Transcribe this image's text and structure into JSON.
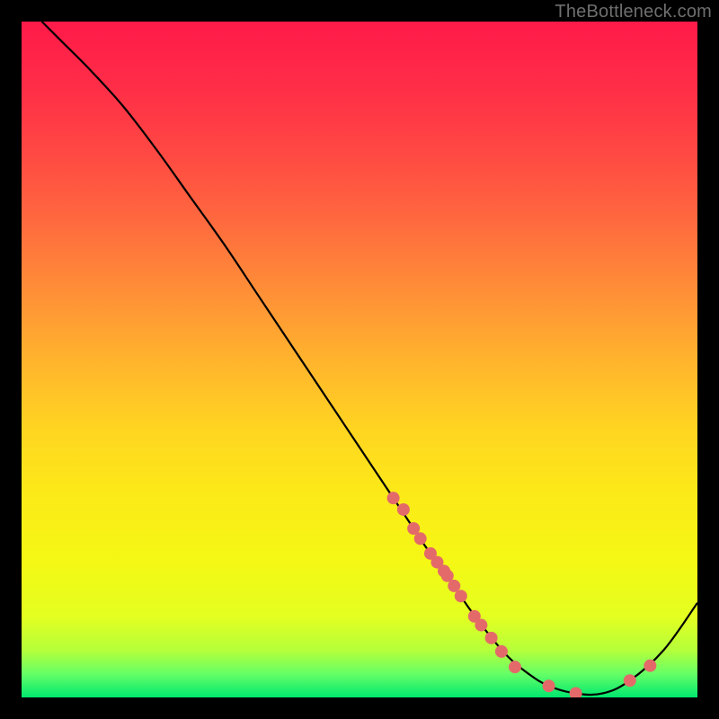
{
  "watermark": "TheBottleneck.com",
  "gradient": {
    "stops": [
      {
        "offset": 0.0,
        "color": "#ff1a49"
      },
      {
        "offset": 0.1,
        "color": "#ff2e47"
      },
      {
        "offset": 0.2,
        "color": "#ff4a43"
      },
      {
        "offset": 0.3,
        "color": "#ff6b3e"
      },
      {
        "offset": 0.4,
        "color": "#ff8f37"
      },
      {
        "offset": 0.5,
        "color": "#ffb32d"
      },
      {
        "offset": 0.6,
        "color": "#ffd421"
      },
      {
        "offset": 0.7,
        "color": "#fcea18"
      },
      {
        "offset": 0.8,
        "color": "#f4f814"
      },
      {
        "offset": 0.88,
        "color": "#e4ff20"
      },
      {
        "offset": 0.93,
        "color": "#b5ff3a"
      },
      {
        "offset": 0.965,
        "color": "#66ff66"
      },
      {
        "offset": 1.0,
        "color": "#00e76f"
      }
    ]
  },
  "chart_data": {
    "type": "line",
    "title": "",
    "xlabel": "",
    "ylabel": "",
    "xlim": [
      0,
      100
    ],
    "ylim": [
      0,
      100
    ],
    "series": [
      {
        "name": "bottleneck-curve",
        "x": [
          3,
          6,
          10,
          15,
          20,
          25,
          30,
          35,
          40,
          45,
          50,
          55,
          58,
          60,
          63,
          66,
          69,
          72,
          75,
          78,
          82,
          86,
          90,
          95,
          100
        ],
        "y": [
          100,
          97,
          93,
          87.5,
          81,
          74,
          67,
          59.5,
          52,
          44.5,
          37,
          29.5,
          25,
          22,
          18,
          13.5,
          9.5,
          6,
          3.5,
          1.7,
          0.6,
          0.6,
          2.5,
          7,
          14
        ]
      }
    ],
    "markers": {
      "name": "data-points",
      "x": [
        55,
        56.5,
        58,
        59,
        60.5,
        61.5,
        62.5,
        63,
        64,
        65,
        67,
        68,
        69.5,
        71,
        73,
        78,
        82,
        90,
        93
      ],
      "y": [
        29.5,
        27.8,
        25,
        23.5,
        21.3,
        20,
        18.7,
        18,
        16.5,
        15,
        12,
        10.7,
        8.8,
        6.8,
        4.5,
        1.7,
        0.6,
        2.5,
        4.7
      ]
    },
    "marker_style": {
      "color": "#e46a6a",
      "radius_px": 7
    }
  }
}
